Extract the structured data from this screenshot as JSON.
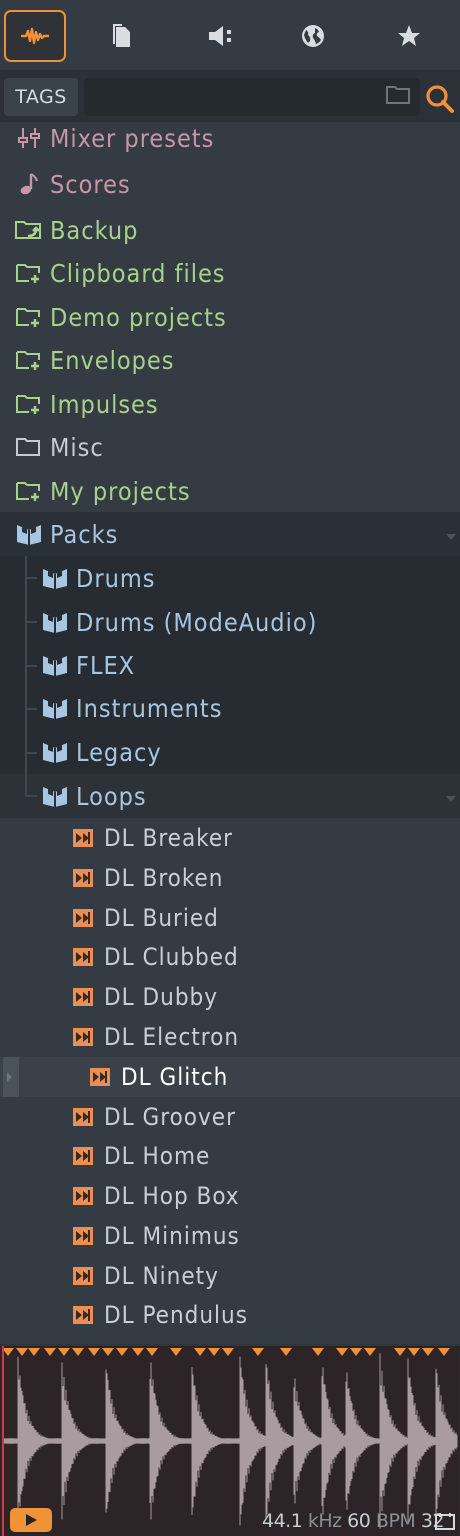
{
  "tabs": [
    {
      "name": "all",
      "icon": "waveform-icon",
      "active": true
    },
    {
      "name": "current-project",
      "icon": "document-icon"
    },
    {
      "name": "plugin-database",
      "icon": "speaker-icon"
    },
    {
      "name": "online",
      "icon": "globe-icon"
    },
    {
      "name": "starred",
      "icon": "star-icon"
    }
  ],
  "search": {
    "tags_label": "TAGS",
    "query": ""
  },
  "tree": {
    "top_items": [
      {
        "label": "Mixer presets",
        "icon": "mixer-icon"
      },
      {
        "label": "Scores",
        "icon": "note-icon"
      },
      {
        "label": "Backup",
        "icon": "backup-folder-icon"
      },
      {
        "label": "Clipboard files",
        "icon": "folder-plus-icon"
      },
      {
        "label": "Demo projects",
        "icon": "folder-plus-icon"
      },
      {
        "label": "Envelopes",
        "icon": "folder-plus-icon"
      },
      {
        "label": "Impulses",
        "icon": "folder-plus-icon"
      },
      {
        "label": "Misc",
        "icon": "folder-icon"
      },
      {
        "label": "My projects",
        "icon": "folder-plus-icon"
      }
    ],
    "packs_label": "Packs",
    "pack_items": [
      "Drums",
      "Drums (ModeAudio)",
      "FLEX",
      "Instruments",
      "Legacy",
      "Loops"
    ],
    "loop_files": [
      "DL Breaker",
      "DL Broken",
      "DL Buried",
      "DL Clubbed",
      "DL Dubby",
      "DL Electron",
      "DL Glitch",
      "DL Groover",
      "DL Home",
      "DL Hop Box",
      "DL Minimus",
      "DL Ninety",
      "DL Pendulus"
    ],
    "selected_file": "DL Glitch"
  },
  "preview": {
    "sample_rate": "44.1",
    "sample_rate_unit": "kHz",
    "tempo": "60",
    "tempo_unit": "BPM",
    "beats": "32"
  },
  "colors": {
    "accent": "#f0913a",
    "folder_green": "#a9d18c",
    "pack_blue": "#a9c6e0"
  }
}
